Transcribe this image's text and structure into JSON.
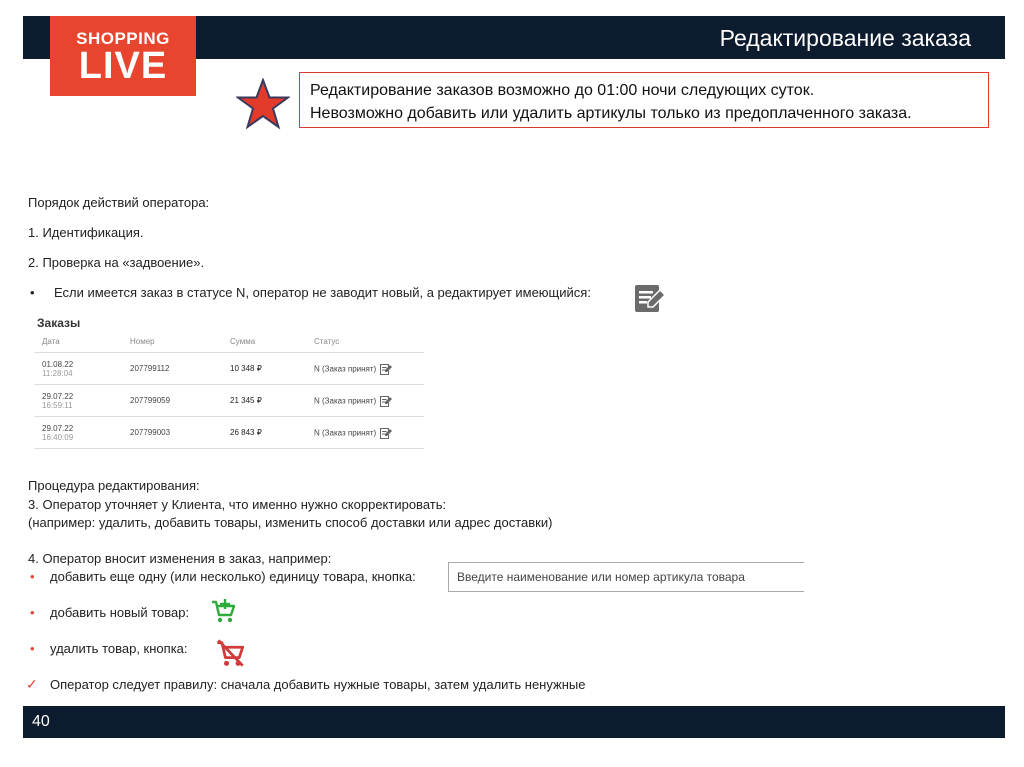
{
  "header": {
    "title": "Редактирование заказа"
  },
  "logo": {
    "top": "SHOPPING",
    "bottom": "LIVE"
  },
  "notice": {
    "line1": "Редактирование заказов возможно до 01:00 ночи следующих суток.",
    "line2": "Невозможно добавить или удалить артикулы только из предоплаченного заказа."
  },
  "steps": {
    "intro": "Порядок действий оператора:",
    "s1": "1. Идентификация.",
    "s2": "2. Проверка на «задвоение».",
    "bullet": "•",
    "s2_note": "Если имеется заказ в статусе N, оператор не заводит новый, а редактирует имеющийся:"
  },
  "orders": {
    "title": "Заказы",
    "columns": [
      "Дата",
      "Номер",
      "Сумма",
      "Статус"
    ],
    "rows": [
      {
        "date": "01.08.22",
        "time": "11:28:04",
        "number": "207799112",
        "sum": "10 348 ₽",
        "status": "N (Заказ принят)"
      },
      {
        "date": "29.07.22",
        "time": "16:59:11",
        "number": "207799059",
        "sum": "21 345 ₽",
        "status": "N (Заказ принят)"
      },
      {
        "date": "29.07.22",
        "time": "16:40:09",
        "number": "207799003",
        "sum": "26 843 ₽",
        "status": "N (Заказ принят)"
      }
    ]
  },
  "procedure": {
    "title": "Процедура редактирования:",
    "s3": "3. Оператор уточняет у Клиента, что именно нужно скорректировать:",
    "s3_note": "(например: удалить, добавить товары, изменить способ доставки или адрес доставки)",
    "s4": "4. Оператор вносит изменения в заказ, например:",
    "b1": "добавить еще одну (или несколько) единицу товара, кнопка:",
    "b2": "добавить новый товар:",
    "b3": "удалить товар, кнопка:",
    "rule": "Оператор следует правилу: сначала добавить нужные товары, затем удалить ненужные",
    "check": "✓"
  },
  "search": {
    "placeholder": "Введите наименование или номер артикула товара"
  },
  "footer": {
    "page": "40"
  },
  "colors": {
    "brand": "#e8452e",
    "navy": "#0d1b2e",
    "add": "#2faa3c",
    "remove": "#d23b3b"
  }
}
